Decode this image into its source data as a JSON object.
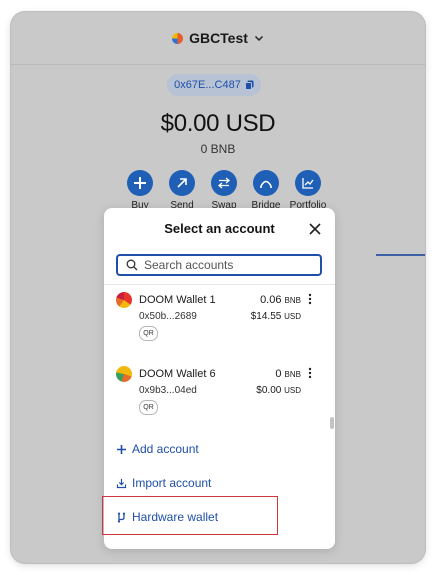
{
  "header": {
    "network_name": "GBCTest"
  },
  "account_address_short": "0x67E...C487",
  "balance": {
    "primary": "$0.00 USD",
    "secondary": "0 BNB"
  },
  "actions": [
    {
      "label": "Buy",
      "icon": "plus-icon"
    },
    {
      "label": "Send",
      "icon": "arrow-up-right-icon"
    },
    {
      "label": "Swap",
      "icon": "swap-arrows-icon"
    },
    {
      "label": "Bridge",
      "icon": "bridge-icon"
    },
    {
      "label": "Portfolio",
      "icon": "chart-icon"
    }
  ],
  "modal": {
    "title": "Select an account",
    "search_placeholder": "Search accounts",
    "accounts": [
      {
        "name": "DOOM Wallet 1",
        "address": "0x50b...2689",
        "qr": "QR",
        "balance_value": "0.06",
        "balance_unit": "BNB",
        "fiat_value": "$14.55",
        "fiat_unit": "USD"
      },
      {
        "name": "DOOM Wallet 6",
        "address": "0x9b3...04ed",
        "qr": "QR",
        "balance_value": "0",
        "balance_unit": "BNB",
        "fiat_value": "$0.00",
        "fiat_unit": "USD"
      }
    ],
    "add_account": "Add account",
    "import_account": "Import account",
    "hardware_wallet": "Hardware wallet"
  },
  "colors": {
    "accent": "#1f4fa8",
    "highlight": "#d0343c",
    "backdrop": "#c9c9ca"
  }
}
